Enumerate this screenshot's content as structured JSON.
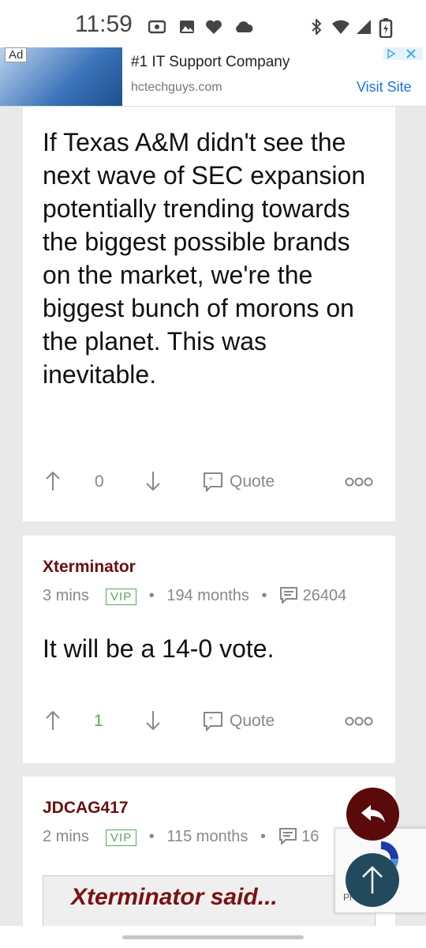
{
  "status_bar": {
    "time": "11:59"
  },
  "ad": {
    "badge": "Ad",
    "title": "#1 IT Support Company",
    "url": "hctechguys.com",
    "cta": "Visit Site"
  },
  "posts": [
    {
      "text": "If Texas A&M didn't see the next wave of SEC expansion potentially trending towards the biggest possible brands on the market, we're the biggest bunch of morons on the planet. This was inevitable.",
      "votes": "0",
      "quote_label": "Quote"
    },
    {
      "username": "Xterminator",
      "time": "3 mins",
      "badge": "VIP",
      "months": "194 months",
      "posts_count": "26404",
      "text": "It will be a 14-0 vote.",
      "votes": "1",
      "quote_label": "Quote"
    },
    {
      "username": "JDCAG417",
      "time": "2 mins",
      "badge": "VIP",
      "months": "115 months",
      "posts_count": "16",
      "quote_author": "Xterminator said..."
    }
  ],
  "recaptcha": {
    "label": "Pr     erms"
  },
  "colors": {
    "username": "#6b0f0f",
    "vip": "#59a85a",
    "vote_positive": "#59a85a",
    "reply_fab": "#5a0a0a",
    "top_fab": "#234a5c"
  }
}
